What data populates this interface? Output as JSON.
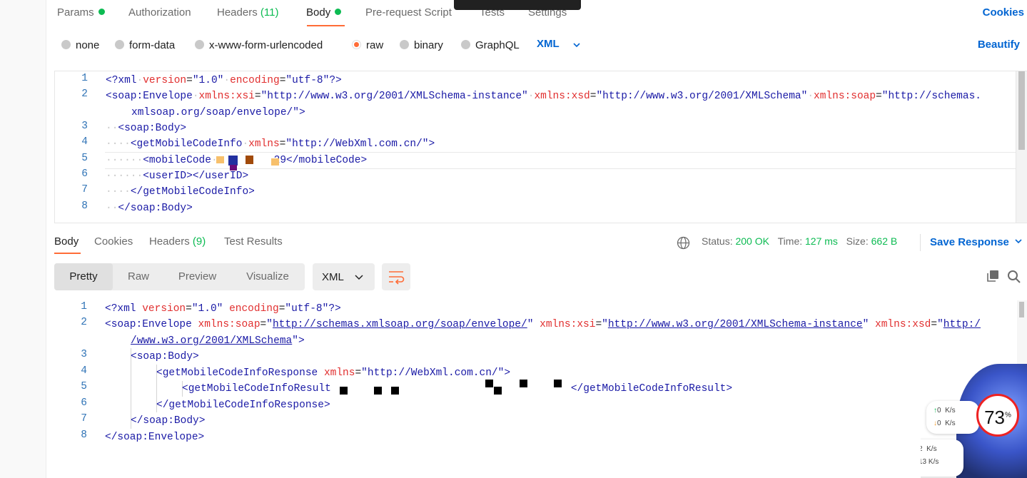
{
  "request_tabs": [
    {
      "label": "Params",
      "dot": true
    },
    {
      "label": "Authorization"
    },
    {
      "label": "Headers",
      "count": "(11)"
    },
    {
      "label": "Body",
      "dot": true,
      "active": true
    },
    {
      "label": "Pre-request Script"
    },
    {
      "label": "Tests"
    },
    {
      "label": "Settings"
    }
  ],
  "cookies_link": "Cookies",
  "body_types": [
    "none",
    "form-data",
    "x-www-form-urlencoded",
    "raw",
    "binary",
    "GraphQL"
  ],
  "body_type_selected": "raw",
  "language": "XML",
  "beautify_label": "Beautify",
  "request_code": {
    "line_numbers": [
      "1",
      "2",
      "3",
      "4",
      "5",
      "6",
      "7",
      "8"
    ],
    "line1": {
      "open": "<?xml",
      "a1": "version",
      "v1": "\"1.0\"",
      "a2": "encoding",
      "v2": "\"utf-8\"",
      "close": "?>"
    },
    "line2": {
      "tag": "<soap:Envelope",
      "a1": "xmlns:xsi",
      "v1": "\"http://www.w3.org/2001/XMLSchema-instance\"",
      "a2": "xmlns:xsd",
      "v2": "\"http://www.w3.org/2001/XMLSchema\"",
      "a3": "xmlns:soap",
      "v3a": "\"http://schemas.",
      "v3b": "xmlsoap.org/soap/envelope/\"",
      "close": ">"
    },
    "line3": "<soap:Body>",
    "line4": {
      "tag": "<getMobileCodeInfo",
      "a1": "xmlns",
      "v1": "\"http://WebXml.com.cn/\"",
      "close": ">"
    },
    "line5": {
      "tag": "<mobileCode",
      "tail": "29</mobileCode>"
    },
    "line6": "<userID></userID>",
    "line7": "</getMobileCodeInfo>",
    "line8": "</soap:Body>"
  },
  "response_tabs": [
    {
      "label": "Body",
      "active": true
    },
    {
      "label": "Cookies"
    },
    {
      "label": "Headers",
      "count": "(9)"
    },
    {
      "label": "Test Results"
    }
  ],
  "status": {
    "status_label": "Status:",
    "status_value": "200 OK",
    "time_label": "Time:",
    "time_value": "127 ms",
    "size_label": "Size:",
    "size_value": "662 B"
  },
  "save_response": "Save Response",
  "view_modes": [
    "Pretty",
    "Raw",
    "Preview",
    "Visualize"
  ],
  "view_mode_selected": "Pretty",
  "format": "XML",
  "response_code": {
    "line_numbers": [
      "1",
      "2",
      "3",
      "4",
      "5",
      "6",
      "7",
      "8"
    ],
    "line1": {
      "open": "<?xml",
      "a1": "version",
      "v1": "\"1.0\"",
      "a2": "encoding",
      "v2": "\"utf-8\"",
      "close": "?>"
    },
    "line2": {
      "tag": "<soap:Envelope",
      "a1": "xmlns:soap",
      "v1": "http://schemas.xmlsoap.org/soap/envelope/",
      "a2": "xmlns:xsi",
      "v2": "http://www.w3.org/2001/XMLSchema-instance",
      "a3": "xmlns:xsd",
      "v3a": "http:/",
      "v3b": "/www.w3.org/2001/XMLSchema",
      "close": ">"
    },
    "line3": "<soap:Body>",
    "line4": {
      "tag": "<getMobileCodeInfoResponse",
      "a1": "xmlns",
      "v1": "\"http://WebXml.com.cn/\"",
      "close": ">"
    },
    "line5": {
      "tag": "<getMobileCodeInfoResult",
      "close": "</getMobileCodeInfoResult>"
    },
    "line6": "</getMobileCodeInfoResponse>",
    "line7": "</soap:Body>",
    "line8": "</soap:Envelope>"
  },
  "widget": {
    "upload1": "0",
    "download1": "0",
    "unit": "K/s",
    "upload2": "2",
    "download2": "13",
    "cpu_percent": "73",
    "percent_sign": "%"
  },
  "colors": {
    "accent": "#ff6c37",
    "link": "#0265d2",
    "success": "#0cbb52"
  }
}
